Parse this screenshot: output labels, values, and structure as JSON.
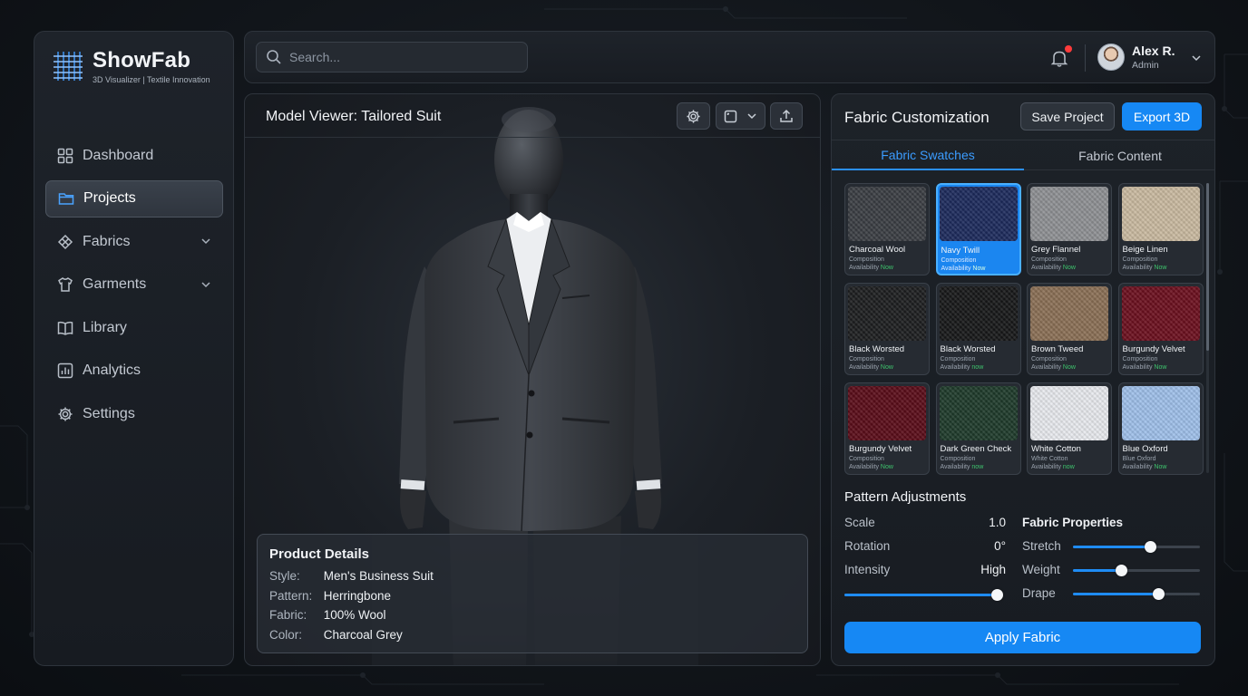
{
  "app": {
    "name": "ShowFab",
    "tagline": "3D Visualizer | Textile Innovation"
  },
  "sidebar": {
    "items": [
      {
        "label": "Dashboard",
        "icon": "grid-icon",
        "active": false,
        "expandable": false
      },
      {
        "label": "Projects",
        "icon": "folder-icon",
        "active": true,
        "expandable": false
      },
      {
        "label": "Fabrics",
        "icon": "fabric-icon",
        "active": false,
        "expandable": true
      },
      {
        "label": "Garments",
        "icon": "shirt-icon",
        "active": false,
        "expandable": true
      },
      {
        "label": "Library",
        "icon": "book-icon",
        "active": false,
        "expandable": false
      },
      {
        "label": "Analytics",
        "icon": "chart-icon",
        "active": false,
        "expandable": false
      },
      {
        "label": "Settings",
        "icon": "gear-icon",
        "active": false,
        "expandable": false
      }
    ]
  },
  "topbar": {
    "search_placeholder": "Search...",
    "notifications_unread": true,
    "user": {
      "name": "Alex R.",
      "role": "Admin"
    }
  },
  "viewer": {
    "title": "Model Viewer: Tailored Suit",
    "details": {
      "title": "Product Details",
      "rows": [
        {
          "key": "Style:",
          "value": "Men's Business Suit"
        },
        {
          "key": "Pattern:",
          "value": "Herringbone"
        },
        {
          "key": "Fabric:",
          "value": "100% Wool"
        },
        {
          "key": "Color:",
          "value": "Charcoal Grey"
        }
      ]
    }
  },
  "panel": {
    "title": "Fabric Customization",
    "save_label": "Save Project",
    "export_label": "Export 3D",
    "tabs": [
      {
        "label": "Fabric Swatches",
        "active": true
      },
      {
        "label": "Fabric Content",
        "active": false
      }
    ],
    "swatches": [
      {
        "name": "Charcoal Wool",
        "composition": "Composition",
        "availability": "Availability",
        "status": "Now",
        "selected": false,
        "color": "#3a3d42"
      },
      {
        "name": "Navy Twill",
        "composition": "Composition",
        "availability": "Availability",
        "status": "Now",
        "selected": true,
        "color": "#1c2a5c"
      },
      {
        "name": "Grey Flannel",
        "composition": "Composition",
        "availability": "Availability",
        "status": "Now",
        "selected": false,
        "color": "#8e9093"
      },
      {
        "name": "Beige Linen",
        "composition": "Composition",
        "availability": "Availability",
        "status": "Now",
        "selected": false,
        "color": "#c9b9a0"
      },
      {
        "name": "Black Worsted",
        "composition": "Composition",
        "availability": "Availability",
        "status": "Now",
        "selected": false,
        "color": "#1c1d1f"
      },
      {
        "name": "Black Worsted",
        "composition": "Composition",
        "availability": "Availability",
        "status": "now",
        "selected": false,
        "color": "#161718"
      },
      {
        "name": "Brown Tweed",
        "composition": "Composition",
        "availability": "Availability",
        "status": "Now",
        "selected": false,
        "color": "#8a6f55"
      },
      {
        "name": "Burgundy Velvet",
        "composition": "Composition",
        "availability": "Availability",
        "status": "Now",
        "selected": false,
        "color": "#6b0f1e"
      },
      {
        "name": "Burgundy Velvet",
        "composition": "Composition",
        "availability": "Availability",
        "status": "Now",
        "selected": false,
        "color": "#5a0c18"
      },
      {
        "name": "Dark Green Check",
        "composition": "Composition",
        "availability": "Availability",
        "status": "now",
        "selected": false,
        "color": "#1e3a2a"
      },
      {
        "name": "White Cotton",
        "composition": "White Cotton",
        "availability": "Availability",
        "status": "now",
        "selected": false,
        "color": "#e8eaee"
      },
      {
        "name": "Blue Oxford",
        "composition": "Blue Oxford",
        "availability": "Availability",
        "status": "Now",
        "selected": false,
        "color": "#9fc0ea"
      }
    ],
    "pattern": {
      "title": "Pattern Adjustments",
      "scale_label": "Scale",
      "scale_value": "1.0",
      "rotation_label": "Rotation",
      "rotation_value": "0°",
      "intensity_label": "Intensity",
      "intensity_value": "High",
      "intensity_level": 0.98
    },
    "properties": {
      "title": "Fabric Properties",
      "items": [
        {
          "label": "Stretch",
          "level": 0.61
        },
        {
          "label": "Weight",
          "level": 0.38
        },
        {
          "label": "Drape",
          "level": 0.67
        }
      ]
    },
    "apply_label": "Apply Fabric"
  },
  "colors": {
    "accent": "#1688f4",
    "available": "#3ec46d",
    "notification": "#ff3b3b"
  }
}
